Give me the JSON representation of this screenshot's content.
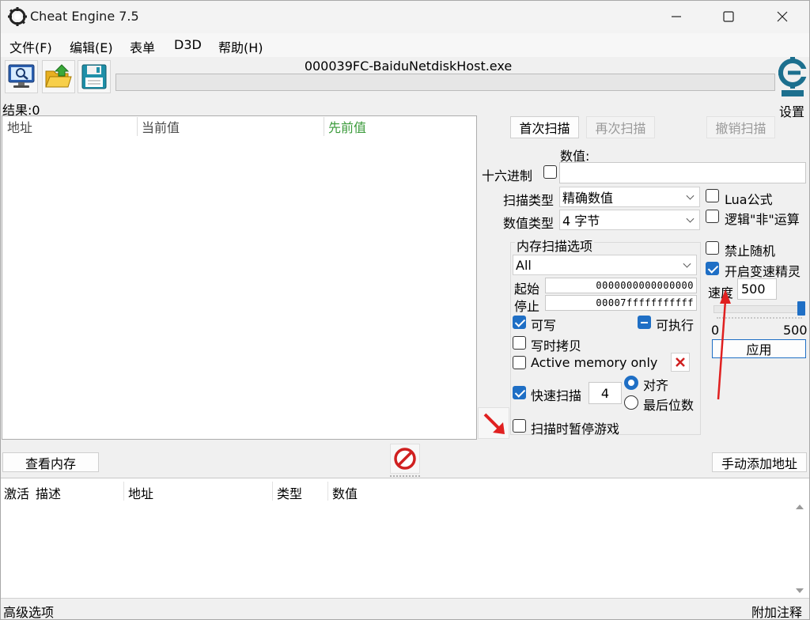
{
  "window": {
    "title": "Cheat Engine 7.5",
    "process": "000039FC-BaiduNetdiskHost.exe"
  },
  "menu": [
    "文件(F)",
    "编辑(E)",
    "表单",
    "D3D",
    "帮助(H)"
  ],
  "toolbar": {
    "icons": [
      "computer-icon",
      "open-folder-icon",
      "save-disk-icon"
    ],
    "settings_label": "设置"
  },
  "results": {
    "label": "结果:0"
  },
  "found_list": {
    "columns": [
      "地址",
      "当前值",
      "先前值"
    ],
    "previous_color": "#3a9a3a"
  },
  "scan": {
    "first_scan": "首次扫描",
    "next_scan": "再次扫描",
    "undo_scan": "撤销扫描",
    "value_label": "数值:",
    "hex_label": "十六进制",
    "value": "",
    "scan_type_label": "扫描类型",
    "scan_type": "精确数值",
    "value_type_label": "数值类型",
    "value_type": "4 字节",
    "lua_formula": "Lua公式",
    "logical_not": "逻辑\"非\"运算",
    "no_random": "禁止随机",
    "speedhack": "开启变速精灵",
    "speed_label": "速度",
    "speed_value": "500",
    "speed_fraction": 1.0,
    "slider_min": "0",
    "slider_max": "500",
    "apply": "应用"
  },
  "memory_options": {
    "title": "内存扫描选项",
    "region": "All",
    "start_label": "起始",
    "start": "0000000000000000",
    "stop_label": "停止",
    "stop": "00007fffffffffff",
    "writable": "可写",
    "executable": "可执行",
    "copy_on_write": "写时拷贝",
    "active_memory": "Active memory only",
    "fast_scan": "快速扫描",
    "fast_scan_value": "4",
    "alignment": "对齐",
    "last_digits": "最后位数",
    "pause_game": "扫描时暂停游戏"
  },
  "bottom": {
    "view_memory": "查看内存",
    "add_address": "手动添加地址"
  },
  "address_list": {
    "columns": [
      "激活",
      "描述",
      "地址",
      "类型",
      "数值"
    ]
  },
  "status": {
    "advanced": "高级选项",
    "comments": "附加注释"
  },
  "colors": {
    "accent": "#1f6fc5",
    "annotation_arrow": "#e02020",
    "stop_icon": "#d02020"
  }
}
